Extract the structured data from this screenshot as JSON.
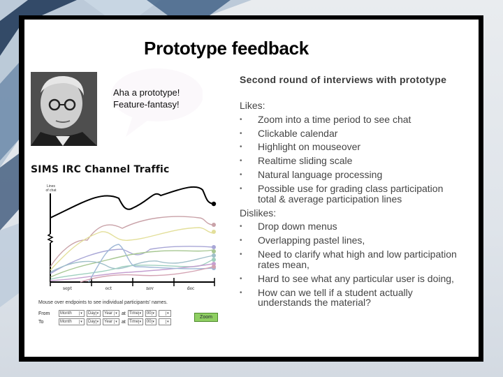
{
  "slide": {
    "title": "Prototype feedback",
    "subtitle": "Second round of interviews with prototype"
  },
  "speech_bubble": {
    "line1": "Aha a prototype!",
    "line2": "Feature-fantasy!"
  },
  "prototype_screenshot": {
    "chart_title": "SIMS IRC Channel Traffic",
    "y_axis_label_line1": "Lines",
    "y_axis_label_line2": "of chat",
    "x_ticks": [
      "sept",
      "oct",
      "nov",
      "dec"
    ],
    "hint": "Mouse over endpoints to see individual participants' names.",
    "from_label": "From",
    "to_label": "To",
    "month_placeholder": "Month",
    "day_placeholder": "Day",
    "year_placeholder": "Year",
    "at_label": "at",
    "time_placeholder": "Time",
    "minutes_value": "00",
    "zoom_label": "Zoom",
    "series_colors": [
      "#000000",
      "#c9a2a8",
      "#e3df9a",
      "#a8a6d6",
      "#a7c792",
      "#9fbfc9",
      "#9fd0bf",
      "#c59fd0",
      "#d3a2b2"
    ]
  },
  "likes": {
    "heading": "Likes:",
    "items": [
      "Zoom into a time period to see chat",
      "Clickable calendar",
      "Highlight on mouseover",
      "Realtime sliding scale",
      "Natural language processing",
      "Possible use for grading class participation"
    ],
    "continuation": "total & average participation lines"
  },
  "dislikes": {
    "heading": "Dislikes:",
    "items": [
      "Drop down menus",
      "Overlapping pastel lines,",
      "Need to clarify what high and low participation",
      "Hard to see what any particular user is doing,",
      "How can we tell if a student actually"
    ],
    "continuation_2": "rates mean,",
    "continuation_4": "understands the material?"
  },
  "bullet": "•"
}
